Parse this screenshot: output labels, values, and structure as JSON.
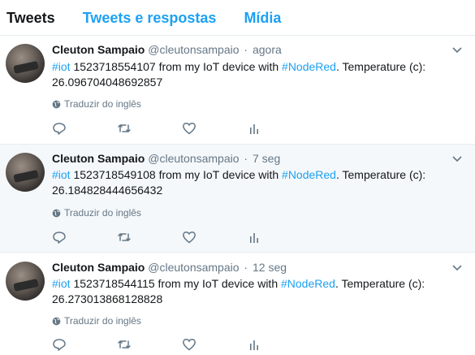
{
  "tabs": [
    {
      "label": "Tweets",
      "active": true
    },
    {
      "label": "Tweets e respostas",
      "active": false
    },
    {
      "label": "Mídia",
      "active": false
    }
  ],
  "translate_label": "Traduzir do inglês",
  "tweets": [
    {
      "name": "Cleuton Sampaio",
      "handle": "@cleutonsampaio",
      "separator": "·",
      "time": "agora",
      "hashtag1": "#iot",
      "text1": " 1523718554107 from my IoT device with ",
      "hashtag2": "#NodeRed",
      "text2": ". Temperature (c): 26.096704048692857",
      "highlighted": false
    },
    {
      "name": "Cleuton Sampaio",
      "handle": "@cleutonsampaio",
      "separator": "·",
      "time": "7 seg",
      "hashtag1": "#iot",
      "text1": " 1523718549108 from my IoT device with ",
      "hashtag2": "#NodeRed",
      "text2": ". Temperature (c): 26.184828444656432",
      "highlighted": true
    },
    {
      "name": "Cleuton Sampaio",
      "handle": "@cleutonsampaio",
      "separator": "·",
      "time": "12 seg",
      "hashtag1": "#iot",
      "text1": " 1523718544115 from my IoT device with ",
      "hashtag2": "#NodeRed",
      "text2": ". Temperature (c): 26.273013868128828",
      "highlighted": false
    }
  ],
  "icons": {
    "chevron": "chevron-down-icon",
    "globe": "globe-icon",
    "reply": "reply-icon",
    "retweet": "retweet-icon",
    "like": "heart-icon",
    "analytics": "analytics-icon"
  },
  "colors": {
    "accent": "#1da1f2",
    "muted": "#657786",
    "highlight_bg": "#f5f8fa",
    "divider": "#e6ecf0"
  }
}
